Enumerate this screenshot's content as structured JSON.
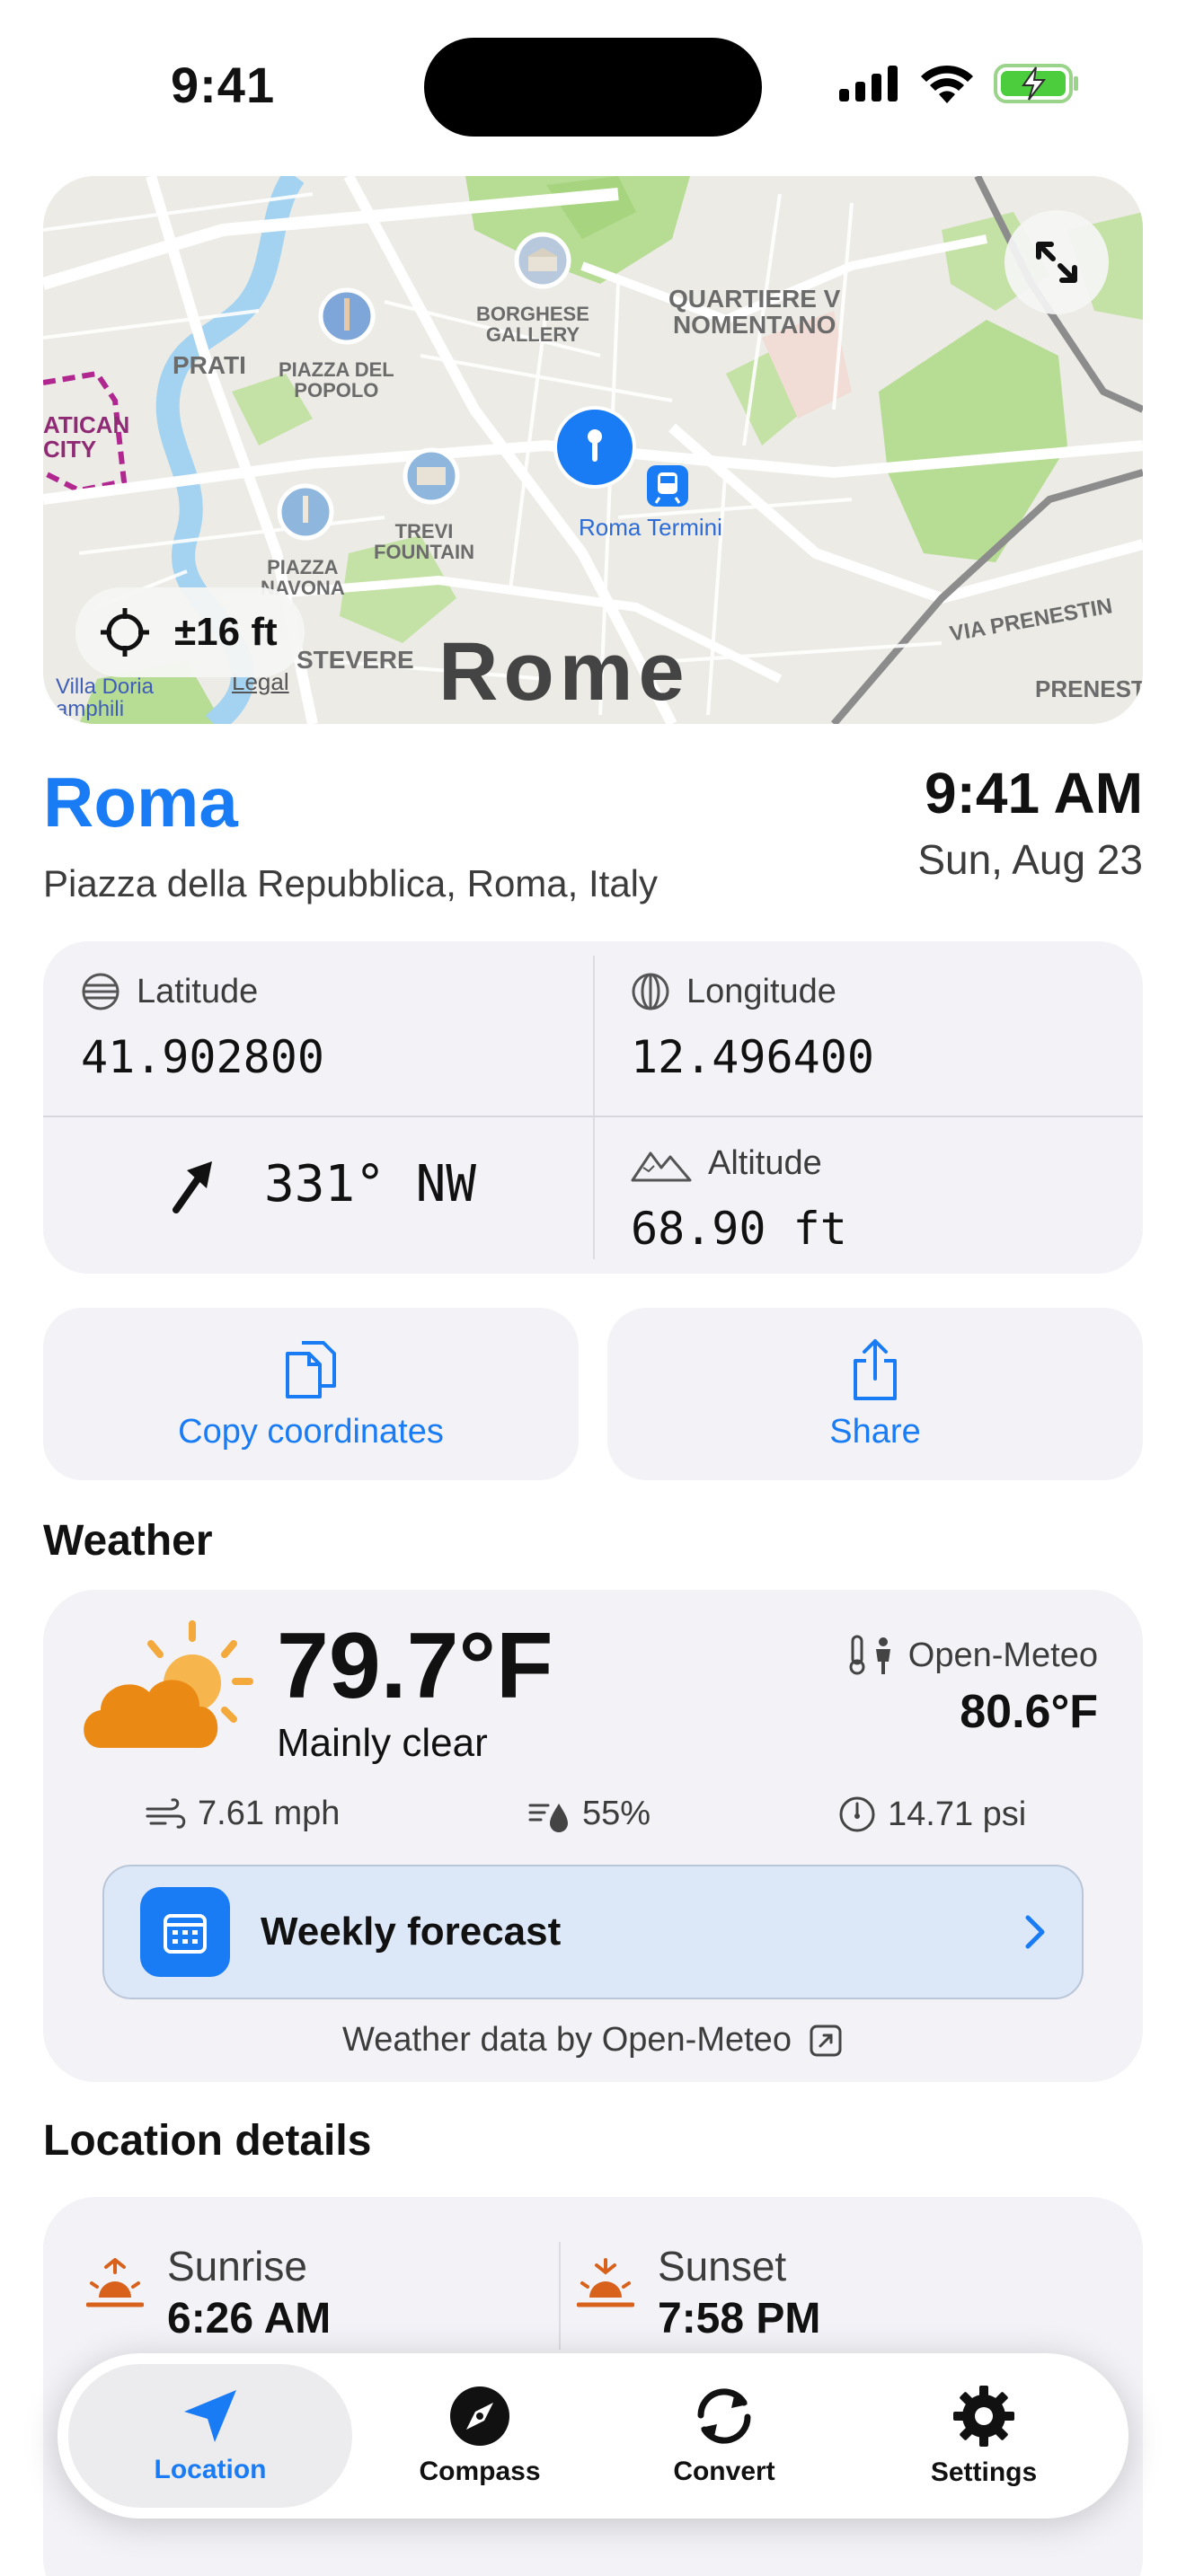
{
  "status_bar": {
    "time": "9:41"
  },
  "map": {
    "labels": {
      "prati": "PRATI",
      "piazza_del_popolo": "PIAZZA DEL\nPOPOLO",
      "borghese": "BORGHESE\nGALLERY",
      "quartiere": "QUARTIERE V\nNOMENTANO",
      "vatican": "ATICAN\nCITY",
      "trevi": "TREVI\nFOUNTAIN",
      "piazza_navona": "PIAZZA\nNAVONA",
      "roma_termini": "Roma Termini",
      "trastevere": "STEVERE",
      "via_prenestina": "VIA PRENESTIN",
      "prenestino": "PRENEST",
      "villa": "Villa Doria\namphili"
    },
    "city": "Rome",
    "accuracy": "±16 ft",
    "legal": "Legal"
  },
  "place": {
    "name": "Roma",
    "address": "Piazza della Repubblica, Roma, Italy",
    "time": "9:41 AM",
    "date": "Sun, Aug 23"
  },
  "coordinates": {
    "latitude_label": "Latitude",
    "latitude": "41.902800",
    "longitude_label": "Longitude",
    "longitude": "12.496400",
    "heading": "331° NW",
    "altitude_label": "Altitude",
    "altitude": "68.90 ft"
  },
  "actions": {
    "copy": "Copy coordinates",
    "share": "Share"
  },
  "weather": {
    "section_title": "Weather",
    "temperature": "79.7°F",
    "condition": "Mainly clear",
    "provider": "Open-Meteo",
    "feels_like": "80.6°F",
    "wind": "7.61 mph",
    "humidity": "55%",
    "pressure": "14.71 psi",
    "forecast_label": "Weekly forecast",
    "attribution": "Weather data by Open-Meteo"
  },
  "details": {
    "section_title": "Location details",
    "sunrise_label": "Sunrise",
    "sunrise": "6:26 AM",
    "sunset_label": "Sunset",
    "sunset": "7:58 PM"
  },
  "tabs": [
    {
      "label": "Location",
      "active": true
    },
    {
      "label": "Compass",
      "active": false
    },
    {
      "label": "Convert",
      "active": false
    },
    {
      "label": "Settings",
      "active": false
    }
  ],
  "colors": {
    "accent": "#1a7cf5",
    "card": "#f2f2f7",
    "sun_orange": "#e07a2c"
  }
}
